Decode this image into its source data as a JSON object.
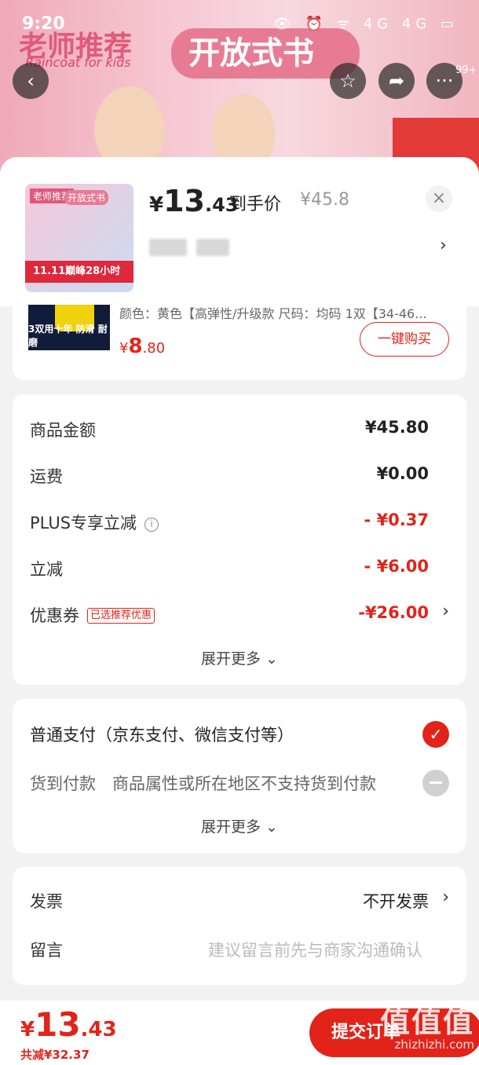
{
  "status_bar": {
    "time": "9:20",
    "icons": "👁 ⏰ ᯤ 4G 4G ▭"
  },
  "banner": {
    "title_left": "老师推荐",
    "subtitle_left": "Raincoat for kids",
    "title_mid": "开放式书",
    "badge_count": "99+"
  },
  "product": {
    "price_symbol": "¥",
    "price_int": "13",
    "price_dec": ".43",
    "price_label": "到手价",
    "original_price": "¥45.8",
    "thumb_tag1": "老师推荐",
    "thumb_tag2": "开放式书",
    "thumb_banner": "11.11巅峰28小时"
  },
  "promo": {
    "description": "颜色：黄色【高弹性/升级款  尺码：均码 1双【34-46...",
    "image_caption": "3双用十年 防滑 耐磨",
    "price_symbol": "¥",
    "price_int": "8",
    "price_dec": ".80",
    "buy_label": "一键购买"
  },
  "summary": {
    "rows": [
      {
        "label": "商品金额",
        "value": "¥45.80"
      },
      {
        "label": "运费",
        "value": "¥0.00"
      },
      {
        "label": "PLUS专享立减",
        "value": "- ¥0.37"
      },
      {
        "label": "立减",
        "value": "- ¥6.00"
      },
      {
        "label": "优惠券",
        "value": "-¥26.00",
        "tag": "已选推荐优惠"
      }
    ],
    "expand": "展开更多 ⌄"
  },
  "payment": {
    "normal": "普通支付（京东支付、微信支付等）",
    "cod_label": "货到付款",
    "cod_note": "商品属性或所在地区不支持货到付款",
    "expand": "展开更多 ⌄"
  },
  "extras": {
    "invoice_label": "发票",
    "invoice_value": "不开发票",
    "note_label": "留言",
    "note_placeholder": "建议留言前先与商家沟通确认"
  },
  "bottom_bar": {
    "price_symbol": "¥",
    "price_int": "13",
    "price_dec": ".43",
    "saved": "共减¥32.37",
    "submit_label": "提交订单"
  },
  "watermark": {
    "text": "值值值",
    "url": "zhizhizhi.com"
  },
  "colors": {
    "accent": "#e2231a"
  }
}
